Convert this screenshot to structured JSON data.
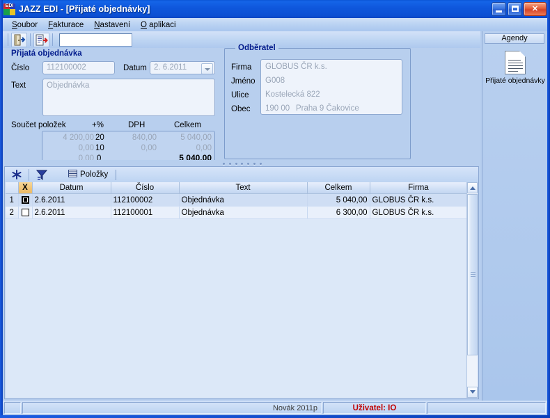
{
  "window": {
    "title": "JAZZ EDI - [Přijaté objednávky]",
    "icon": "app-logo-icon",
    "minimize_label": "_",
    "maximize_label": "□",
    "close_label": "✕"
  },
  "menu": [
    {
      "label": "Soubor",
      "accel": "S"
    },
    {
      "label": "Fakturace",
      "accel": "F"
    },
    {
      "label": "Nastavení",
      "accel": "N"
    },
    {
      "label": "O aplikaci",
      "accel": "O"
    }
  ],
  "toolbar": {
    "buttons": [
      {
        "name": "exit-door-icon",
        "tooltip": "Konec"
      },
      {
        "name": "document-export-icon",
        "tooltip": "Export"
      }
    ],
    "search_value": "",
    "search_placeholder": ""
  },
  "order_form": {
    "group_title": "Přijatá objednávka",
    "cislo_label": "Číslo",
    "cislo_value": "112100002",
    "datum_label": "Datum",
    "datum_value": "2. 6.2011",
    "text_label": "Text",
    "text_value": "Objednávka"
  },
  "customer": {
    "group_title": "Odběratel",
    "firma_label": "Firma",
    "firma_value": "GLOBUS ČR k.s.",
    "jmeno_label": "Jméno",
    "jmeno_value": "G008",
    "ulice_label": "Ulice",
    "ulice_value": "Kostelecká 822",
    "obec_label": "Obec",
    "obec_psc": "190 00",
    "obec_value": "Praha 9  Čakovice"
  },
  "totals": {
    "label_soucet": "Součet položek",
    "label_plus_pct": "+%",
    "label_dph": "DPH",
    "label_celkem": "Celkem",
    "rows": [
      {
        "base": "4 200,00",
        "rate": "20",
        "dph": "840,00",
        "total": "5 040,00"
      },
      {
        "base": "0,00",
        "rate": "10",
        "dph": "0,00",
        "total": "0,00"
      },
      {
        "base": "0,00",
        "rate": "0",
        "dph": "",
        "total": "5 040,00"
      }
    ],
    "grand_total": "5 040,00"
  },
  "grid_toolbar": {
    "new_icon": "asterisk-new-record-icon",
    "filter_icon": "filter-funnel-icon",
    "tab_icon": "grid-lines-icon",
    "tab_label": "Položky"
  },
  "grid": {
    "columns": [
      {
        "key": "rownum",
        "label": ""
      },
      {
        "key": "x",
        "label": "X"
      },
      {
        "key": "datum",
        "label": "Datum"
      },
      {
        "key": "cislo",
        "label": "Číslo"
      },
      {
        "key": "text",
        "label": "Text"
      },
      {
        "key": "celkem",
        "label": "Celkem"
      },
      {
        "key": "firma",
        "label": "Firma"
      }
    ],
    "rows": [
      {
        "rownum": "1",
        "checked": true,
        "datum": "2.6.2011",
        "cislo": "112100002",
        "text": "Objednávka",
        "celkem": "5 040,00",
        "firma": "GLOBUS ČR k.s.",
        "selected": true
      },
      {
        "rownum": "2",
        "checked": false,
        "datum": "2.6.2011",
        "cislo": "112100001",
        "text": "Objednávka",
        "celkem": "6 300,00",
        "firma": "GLOBUS ČR k.s.",
        "selected": false
      }
    ]
  },
  "agendy": {
    "header_label": "Agendy",
    "item_icon": "document-lines-icon",
    "item_label": "Přijaté objednávky"
  },
  "status_bar": {
    "pane1": "",
    "pane2": "Novák 2011p",
    "pane3": "Uživatel: IO",
    "pane4": ""
  },
  "colors": {
    "title_bar": "#0f58dd",
    "accent_orange": "#f0c477",
    "group_title": "#001a8c",
    "user_red": "#c00000",
    "client_bg": "#b5cdee"
  }
}
